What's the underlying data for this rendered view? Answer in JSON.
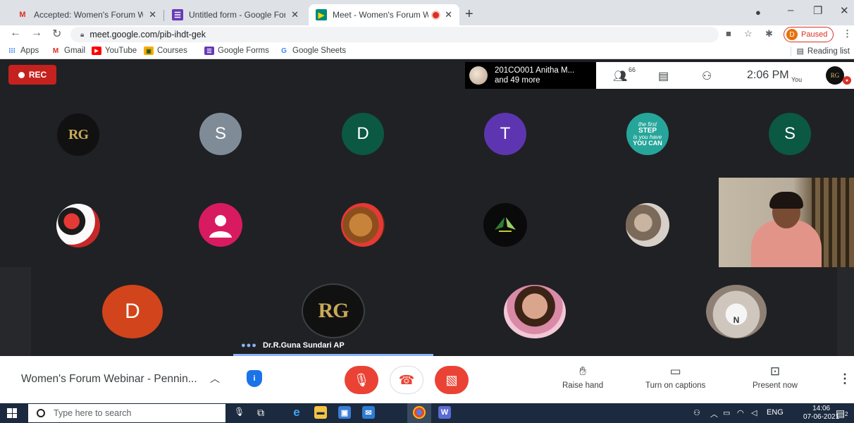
{
  "browser": {
    "tabs": [
      {
        "title": "Accepted: Women's Forum Webi",
        "icon": "gmail-icon"
      },
      {
        "title": "Untitled form - Google Forms",
        "icon": "forms-icon"
      },
      {
        "title": "Meet - Women's Forum Web",
        "icon": "meet-icon"
      }
    ],
    "url": "meet.google.com/pib-ihdt-gek",
    "profile_status": "Paused",
    "profile_initial": "D",
    "bookmarks": [
      "Apps",
      "Gmail",
      "YouTube",
      "Courses",
      "Google Forms",
      "Google Sheets"
    ],
    "reading_list": "Reading list"
  },
  "meet": {
    "rec_label": "REC",
    "speaker_line1": "201CO001 Anitha M...",
    "speaker_line2": "and 49 more",
    "participant_count": "66",
    "time": "2:06 PM",
    "you_label": "You",
    "you_avatar": "RG",
    "grid": {
      "row1": [
        "RG",
        "S",
        "D",
        "T",
        "the first STEP",
        "S"
      ],
      "row1_first_step": [
        "the first",
        "STEP",
        "is you have",
        "YOU CAN"
      ],
      "row3": [
        "D",
        "RG"
      ],
      "row3_n": "N",
      "active_speaker": "Dr.R.Guna Sundari AP"
    },
    "meeting_title": "Women's Forum Webinar - Pennin...",
    "actions": {
      "raise_hand": "Raise hand",
      "captions": "Turn on captions",
      "present": "Present now"
    },
    "colors": {
      "record_red": "#c5221f",
      "avatar_gray": "#7f8c97",
      "avatar_green": "#0b5843",
      "avatar_purple": "#5e35b1",
      "avatar_orange": "#d2441b",
      "avatar_pink": "#d81b60",
      "speaker_highlight": "#8ab4f8"
    }
  },
  "taskbar": {
    "search_placeholder": "Type here to search",
    "lang": "ENG",
    "time": "14:06",
    "date": "07-06-2021",
    "notif_count": "2"
  }
}
